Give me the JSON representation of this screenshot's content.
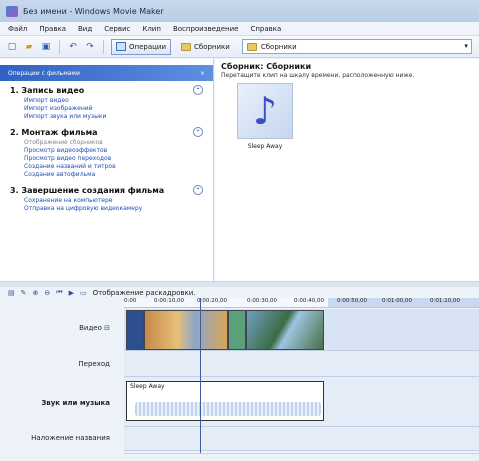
{
  "window": {
    "title": "Без имени - Windows Movie Maker"
  },
  "menu": [
    "Файл",
    "Правка",
    "Вид",
    "Сервис",
    "Клип",
    "Воспроизведение",
    "Справка"
  ],
  "toolbar": {
    "operations_label": "Операции",
    "collections_label": "Сборники",
    "collection_combo": "Сборники"
  },
  "task_pane": {
    "header": "Операции с фильмами",
    "sections": [
      {
        "title": "1. Запись видео",
        "links": [
          "Импорт видео",
          "Импорт изображений",
          "Импорт звука или музыки"
        ]
      },
      {
        "title": "2. Монтаж фильма",
        "links": [
          "Отображение сборников",
          "Просмотр видеоэффектов",
          "Просмотр видео переходов",
          "Создание названий и титров",
          "Создание автофильма"
        ]
      },
      {
        "title": "3. Завершение создания фильма",
        "links": [
          "Сохранение на компьютере",
          "Отправка на цифровую видеокамеру"
        ]
      }
    ]
  },
  "collection": {
    "title": "Сборник: Сборники",
    "hint": "Перетащите клип на шкалу времени, расположенную ниже.",
    "clip_name": "Sleep Away"
  },
  "timeline": {
    "toggle_label": "Отображение раскадровки.",
    "ruler": [
      "0:00",
      "0:00:10,00",
      "0:00:20,00",
      "0:00:30,00",
      "0:00:40,00",
      "0:00:50,00",
      "0:01:00,00",
      "0:01:10,00"
    ],
    "tracks": {
      "video": "Видео",
      "transition": "Переход",
      "audio": "Звук или музыка",
      "title": "Наложение названия"
    },
    "audio_clip": "Sleep Away"
  },
  "colors": {
    "accent": "#2f62c4",
    "link": "#1d4fb8"
  }
}
